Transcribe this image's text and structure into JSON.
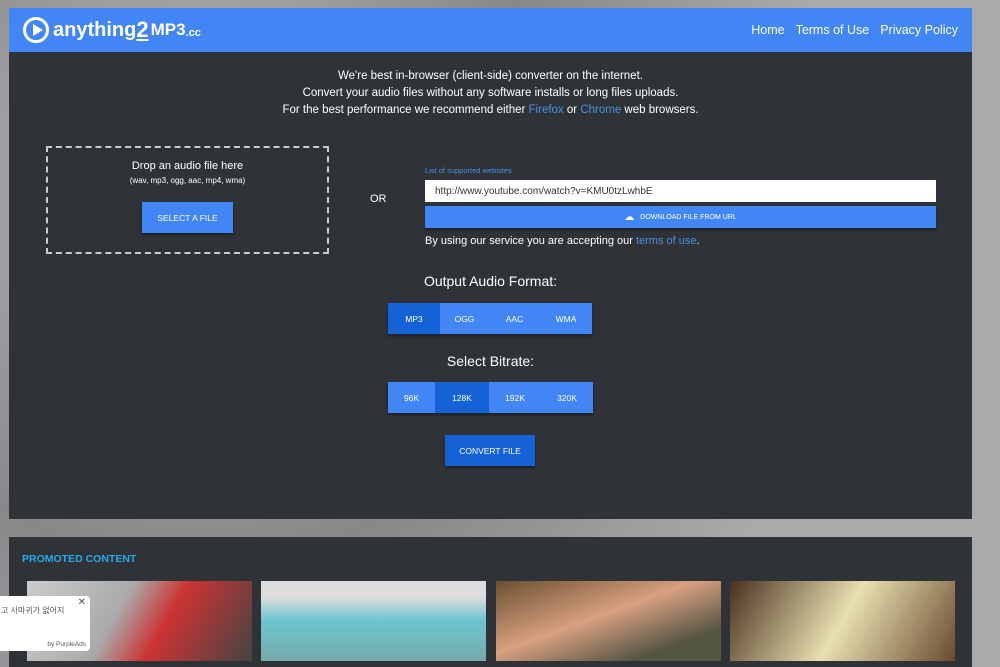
{
  "header": {
    "logo": {
      "main": "anything",
      "two": "2",
      "mp3": "MP3",
      "tld": ".cc"
    },
    "nav": [
      "Home",
      "Terms of Use",
      "Privacy Policy"
    ]
  },
  "intro": {
    "line1": "We're best in-browser (client-side) converter on the internet.",
    "line2": "Convert your audio files without any software installs or long files uploads.",
    "line3_pre": "For the best performance we recommend either ",
    "firefox": "Firefox",
    "or": " or ",
    "chrome": "Chrome",
    "line3_post": " web browsers."
  },
  "drop": {
    "title": "Drop an audio file here",
    "formats": "(wav, mp3, ogg, aac, mp4, wma)",
    "button": "SELECT A FILE"
  },
  "or": "OR",
  "url": {
    "supported_link": "List of supported websites",
    "value": "http://www.youtube.com/watch?v=KMU0tzLwhbE",
    "button": "DOWNLOAD FILE FROM URL",
    "note_pre": "By using our service you are accepting our ",
    "terms": "terms of use",
    "note_post": "."
  },
  "format": {
    "title": "Output Audio Format:",
    "options": [
      "MP3",
      "OGG",
      "AAC",
      "WMA"
    ],
    "selected": "MP3"
  },
  "bitrate": {
    "title": "Select Bitrate:",
    "options": [
      "96K",
      "128K",
      "192K",
      "320K"
    ],
    "selected": "128K"
  },
  "convert": "CONVERT FILE",
  "promo": {
    "title": "PROMOTED CONTENT"
  },
  "ad": {
    "text": "고 사마귀가 없어지",
    "by": "by PurpleAds",
    "close": "✕"
  },
  "colors": {
    "brand": "#4285f4",
    "selected": "#1561d6",
    "panel": "#2f3338",
    "link": "#4a90e2"
  }
}
